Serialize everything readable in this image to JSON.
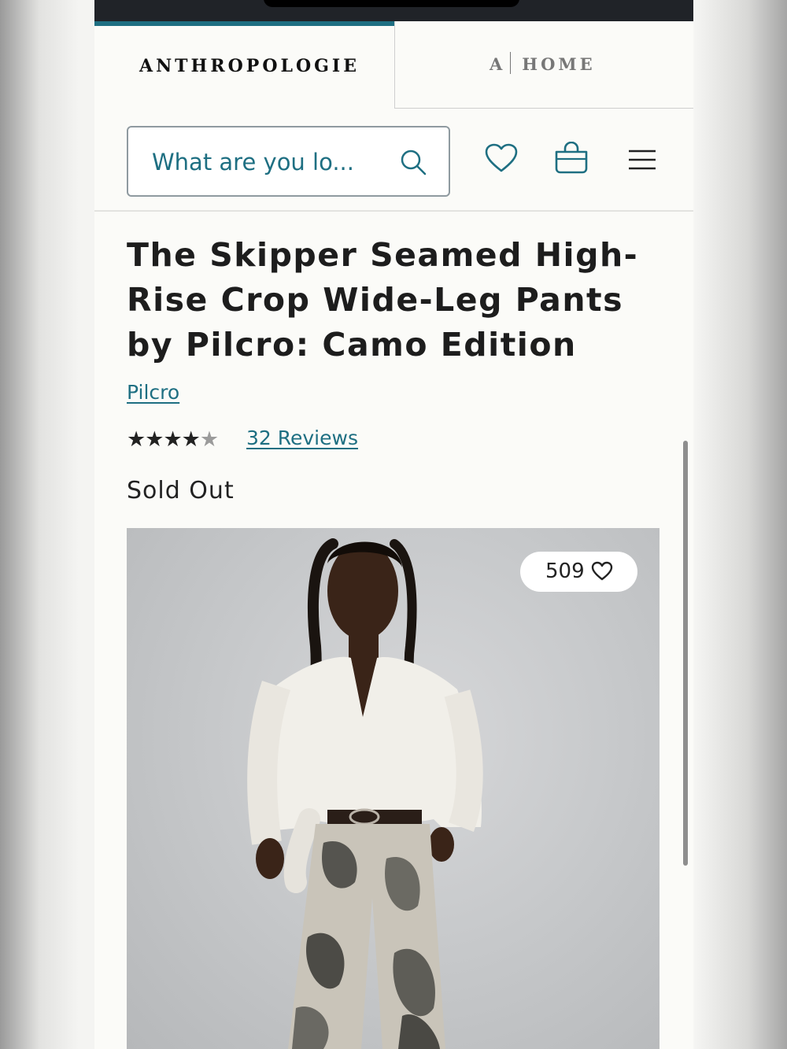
{
  "tabs": {
    "anthropologie": "ANTHROPOLOGIE",
    "home_prefix": "A",
    "home_label": "HOME"
  },
  "search": {
    "placeholder": "What are you lo..."
  },
  "icons": [
    "search-icon",
    "heart-icon",
    "shopping-bag-icon",
    "menu-icon"
  ],
  "product": {
    "title": "The Skipper Seamed High-Rise Crop Wide-Leg Pants by Pilcro: Camo Edition",
    "brand": "Pilcro",
    "rating": 4,
    "rating_max": 5,
    "reviews_label": "32 Reviews",
    "availability": "Sold Out",
    "likes": "509"
  },
  "colors": {
    "accent": "#1e6f82",
    "text": "#1d1d1d",
    "background": "#fbfbf8"
  }
}
